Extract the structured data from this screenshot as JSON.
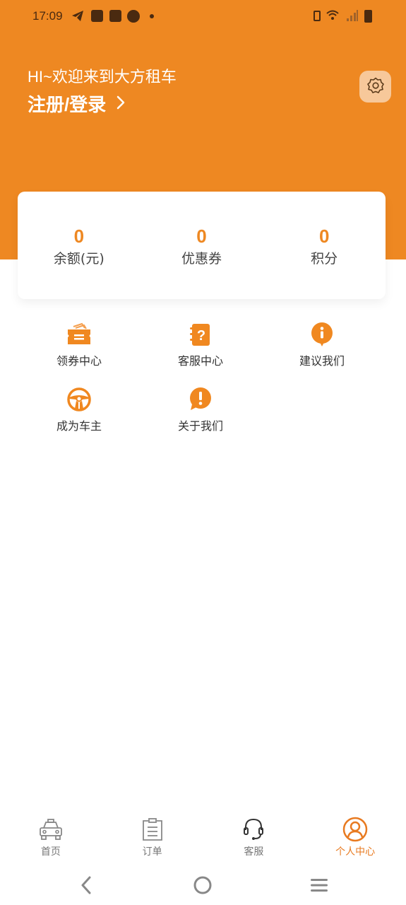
{
  "status_bar": {
    "time": "17:09",
    "left_icons": [
      "telegram-icon",
      "shopping-bag-icon",
      "shopping-bag-icon",
      "speedometer-icon",
      "notification-dot-icon"
    ],
    "right_icons": [
      "vibrate-icon",
      "wifi-icon",
      "signal-icon",
      "battery-icon"
    ]
  },
  "header": {
    "greeting": "HI~欢迎来到大方租车",
    "login_label": "注册/登录",
    "settings_icon": "gear-icon",
    "brand_color": "#EE8822"
  },
  "stats": [
    {
      "value": "0",
      "label": "余额(元)"
    },
    {
      "value": "0",
      "label": "优惠券"
    },
    {
      "value": "0",
      "label": "积分"
    }
  ],
  "menu": [
    {
      "label": "领券中心",
      "icon": "ticket-icon"
    },
    {
      "label": "客服中心",
      "icon": "help-book-icon"
    },
    {
      "label": "建议我们",
      "icon": "info-bubble-icon"
    },
    {
      "label": "成为车主",
      "icon": "steering-wheel-icon"
    },
    {
      "label": "关于我们",
      "icon": "exclamation-bubble-icon"
    }
  ],
  "tabbar": {
    "active_color": "#E87A20",
    "items": [
      {
        "label": "首页",
        "icon": "taxi-icon",
        "active": false
      },
      {
        "label": "订单",
        "icon": "clipboard-icon",
        "active": false
      },
      {
        "label": "客服",
        "icon": "headset-icon",
        "active": false
      },
      {
        "label": "个人中心",
        "icon": "user-circle-icon",
        "active": true
      }
    ]
  },
  "system_nav": [
    "back-icon",
    "home-icon",
    "recents-icon"
  ]
}
